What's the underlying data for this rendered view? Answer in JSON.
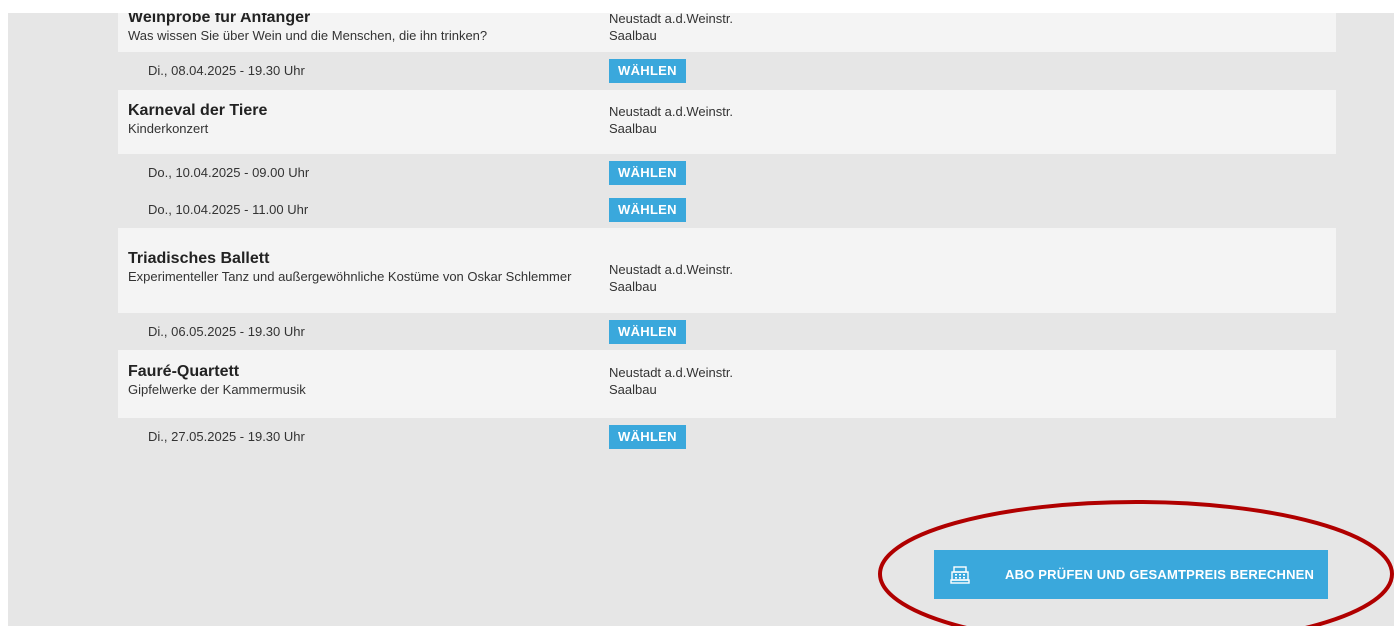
{
  "events": [
    {
      "title": "Weinprobe für Anfänger",
      "subtitle": "Was wissen Sie über Wein und die Menschen, die ihn trinken?",
      "venue_line1": "Neustadt a.d.Weinstr.",
      "venue_line2": "Saalbau",
      "dates": [
        {
          "label": "Di., 08.04.2025 - 19.30 Uhr",
          "button": "WÄHLEN"
        }
      ]
    },
    {
      "title": "Karneval der Tiere",
      "subtitle": "Kinderkonzert",
      "venue_line1": "Neustadt a.d.Weinstr.",
      "venue_line2": "Saalbau",
      "dates": [
        {
          "label": "Do., 10.04.2025 - 09.00 Uhr",
          "button": "WÄHLEN"
        },
        {
          "label": "Do., 10.04.2025 - 11.00 Uhr",
          "button": "WÄHLEN"
        }
      ]
    },
    {
      "title": "Triadisches Ballett",
      "subtitle": "Experimenteller Tanz und außergewöhnliche Kostüme von Oskar Schlemmer",
      "venue_line1": "Neustadt a.d.Weinstr.",
      "venue_line2": "Saalbau",
      "dates": [
        {
          "label": "Di., 06.05.2025 - 19.30 Uhr",
          "button": "WÄHLEN"
        }
      ]
    },
    {
      "title": "Fauré-Quartett",
      "subtitle": "Gipfelwerke der Kammermusik",
      "venue_line1": "Neustadt a.d.Weinstr.",
      "venue_line2": "Saalbau",
      "dates": [
        {
          "label": "Di., 27.05.2025 - 19.30 Uhr",
          "button": "WÄHLEN"
        }
      ]
    }
  ],
  "calc_button": {
    "label": "ABO PRÜFEN UND GESAMTPREIS BERECHNEN",
    "icon": "cash-register-icon"
  },
  "colors": {
    "accent": "#3aa8dc",
    "highlight": "#b00000",
    "panel": "#f4f4f4",
    "background": "#e6e6e6"
  }
}
